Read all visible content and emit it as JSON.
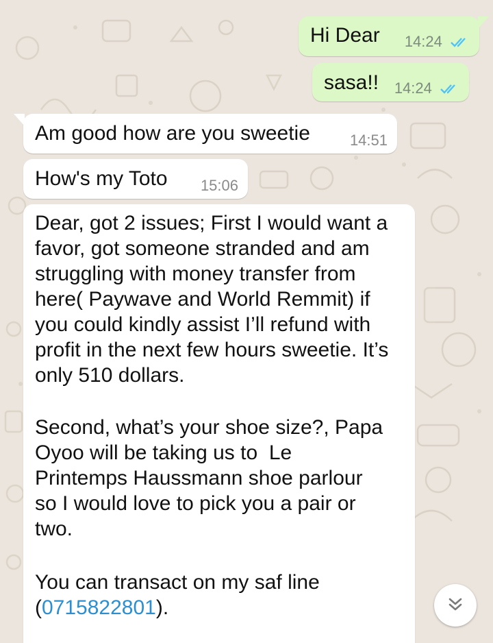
{
  "colors": {
    "outgoing_bubble": "#dcf8c6",
    "incoming_bubble": "#ffffff",
    "chat_background": "#ece5dd",
    "read_ticks": "#4fc3f7",
    "link": "#2b8fd1"
  },
  "messages": [
    {
      "direction": "outgoing",
      "text": "Hi Dear",
      "time": "14:24",
      "status": "read-ticks-icon"
    },
    {
      "direction": "outgoing",
      "text": "sasa!!",
      "time": "14:24",
      "status": "read-ticks-icon"
    },
    {
      "direction": "incoming",
      "text": "Am good how are you sweetie",
      "time": "14:51"
    },
    {
      "direction": "incoming",
      "text": "How's my Toto",
      "time": "15:06"
    },
    {
      "direction": "incoming",
      "paragraphs": [
        "Dear, got 2 issues; First I would want a favor, got someone stranded and am struggling with money transfer from here( Paywave and World Remmit) if you could kindly assist I’ll refund with profit in the next few hours sweetie. It’s only 510 dollars.",
        "Second, what’s your shoe size?, Papa Oyoo will be taking us to  Le Printemps Haussmann shoe parlour so I would love to pick you a pair or two.",
        "You can transact on my saf line"
      ],
      "phone_open": "(",
      "phone": "0715822801",
      "phone_close": ")."
    }
  ],
  "scroll_button": {
    "icon": "double-chevron-down-icon"
  }
}
